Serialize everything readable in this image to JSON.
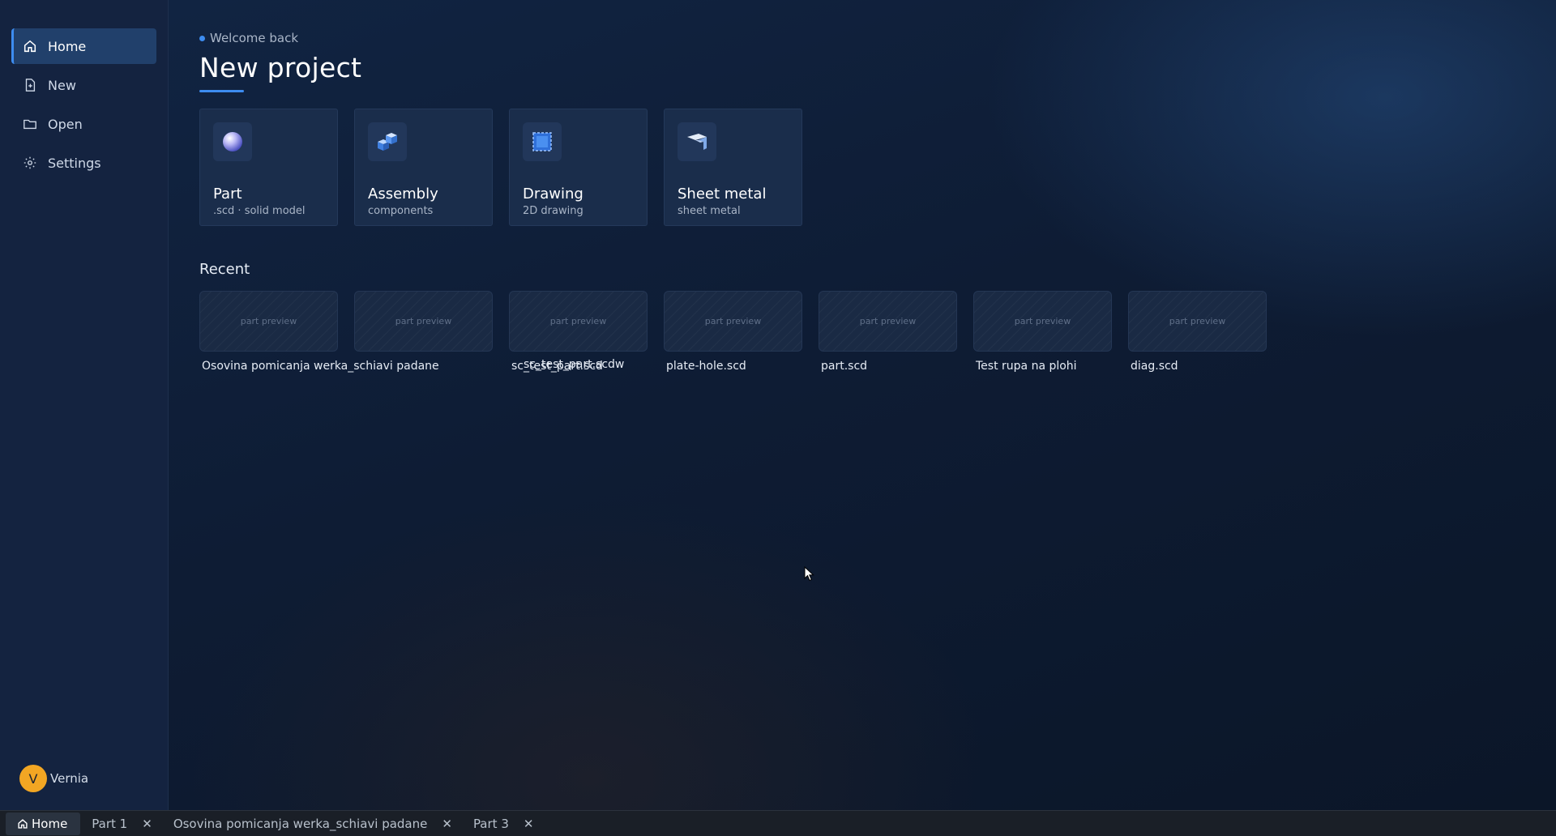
{
  "sidebar": {
    "items": [
      {
        "label": "Home",
        "icon": "home-icon",
        "active": true
      },
      {
        "label": "New",
        "icon": "new-file-icon"
      },
      {
        "label": "Open",
        "icon": "folder-icon"
      },
      {
        "label": "Settings",
        "icon": "gear-icon"
      }
    ],
    "user": {
      "initial": "V",
      "name": "Vernia"
    }
  },
  "main": {
    "welcome": "Welcome back",
    "title": "New project",
    "types": [
      {
        "name": "Part",
        "sub": ".scd · solid model",
        "icon": "sphere-icon"
      },
      {
        "name": "Assembly",
        "sub": "components",
        "icon": "cubes-icon"
      },
      {
        "name": "Drawing",
        "sub": "2D drawing",
        "icon": "drawing-icon"
      },
      {
        "name": "Sheet metal",
        "sub": "sheet metal",
        "icon": "sheet-metal-icon"
      }
    ],
    "recent_title": "Recent",
    "recent": [
      {
        "preview": "part preview",
        "name": "Osovina pomicanja werka_schiavi padane"
      },
      {
        "preview": "part preview",
        "name": "sc_test_part.scdw"
      },
      {
        "preview": "part preview",
        "name": "sc_test_part.scd"
      },
      {
        "preview": "part preview",
        "name": "plate-hole.scd"
      },
      {
        "preview": "part preview",
        "name": "part.scd"
      },
      {
        "preview": "part preview",
        "name": "Test rupa na plohi"
      },
      {
        "preview": "part preview",
        "name": "diag.scd"
      }
    ]
  },
  "tabs": [
    {
      "label": "Home",
      "active": true,
      "closable": false
    },
    {
      "label": "Part 1",
      "closable": true
    },
    {
      "label": "Osovina pomicanja werka_schiavi padane",
      "closable": true
    },
    {
      "label": "Part 3",
      "closable": true
    }
  ],
  "colors": {
    "accent": "#3d8cf0",
    "avatar": "#f2a623"
  }
}
